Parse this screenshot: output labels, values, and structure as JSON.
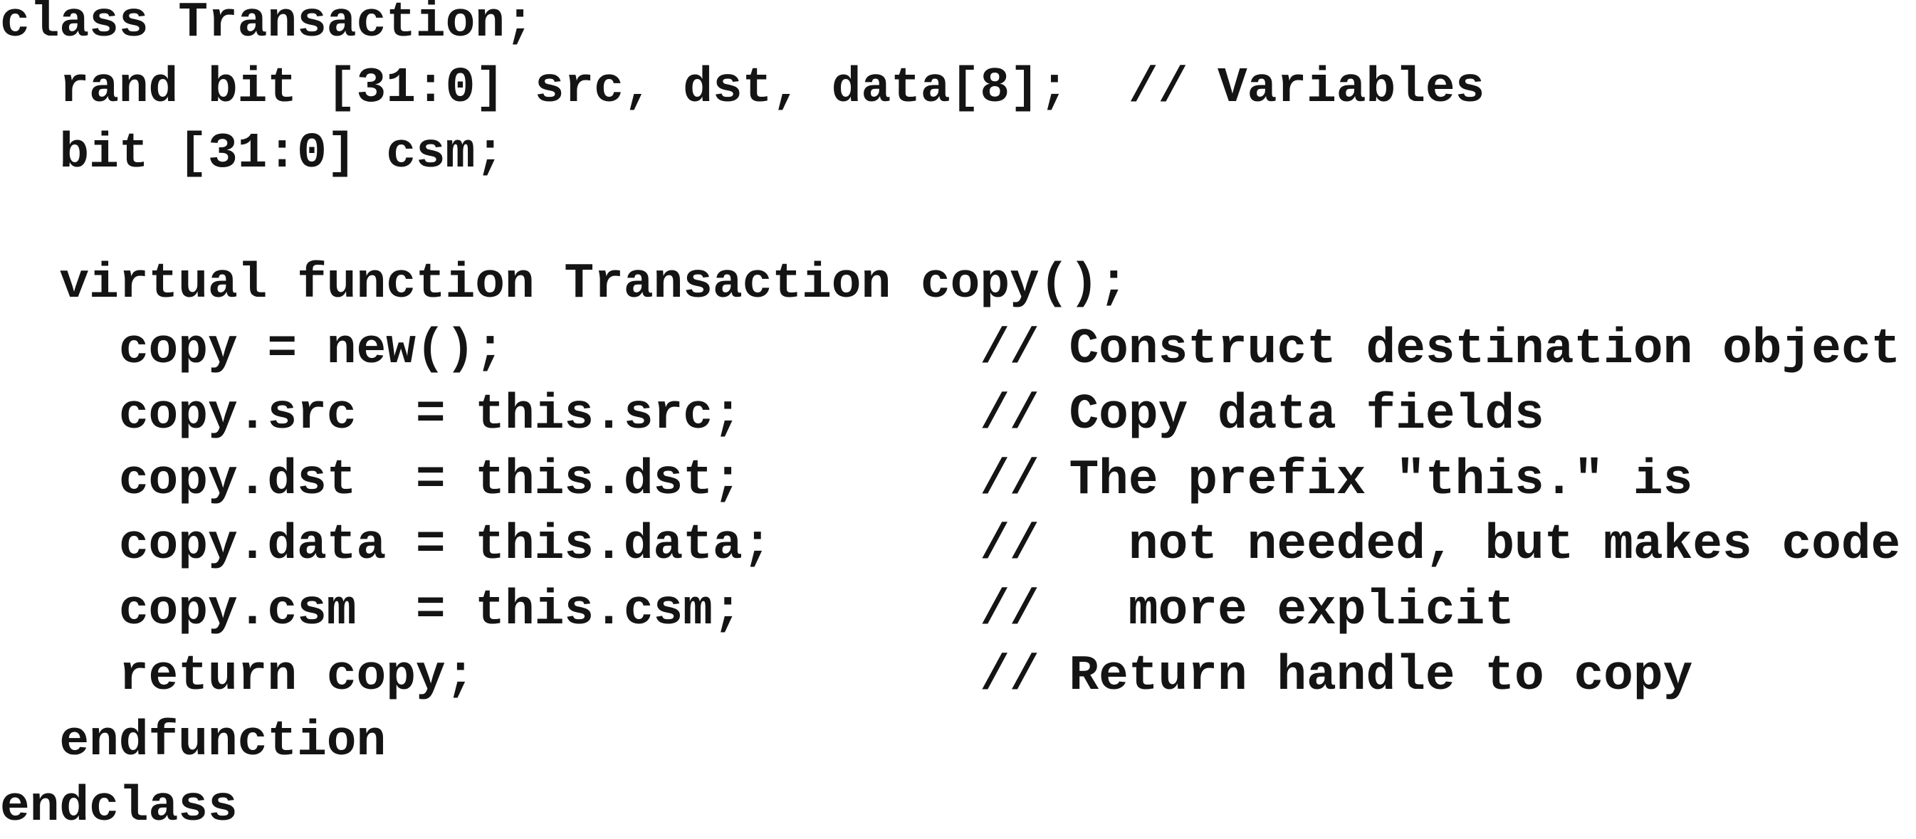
{
  "code_lines": [
    "class Transaction;",
    "  rand bit [31:0] src, dst, data[8];  // Variables",
    "  bit [31:0] csm;",
    "",
    "  virtual function Transaction copy();",
    "    copy = new();                // Construct destination object",
    "    copy.src  = this.src;        // Copy data fields",
    "    copy.dst  = this.dst;        // The prefix \"this.\" is",
    "    copy.data = this.data;       //   not needed, but makes code",
    "    copy.csm  = this.csm;        //   more explicit",
    "    return copy;                 // Return handle to copy",
    "  endfunction",
    "endclass"
  ]
}
